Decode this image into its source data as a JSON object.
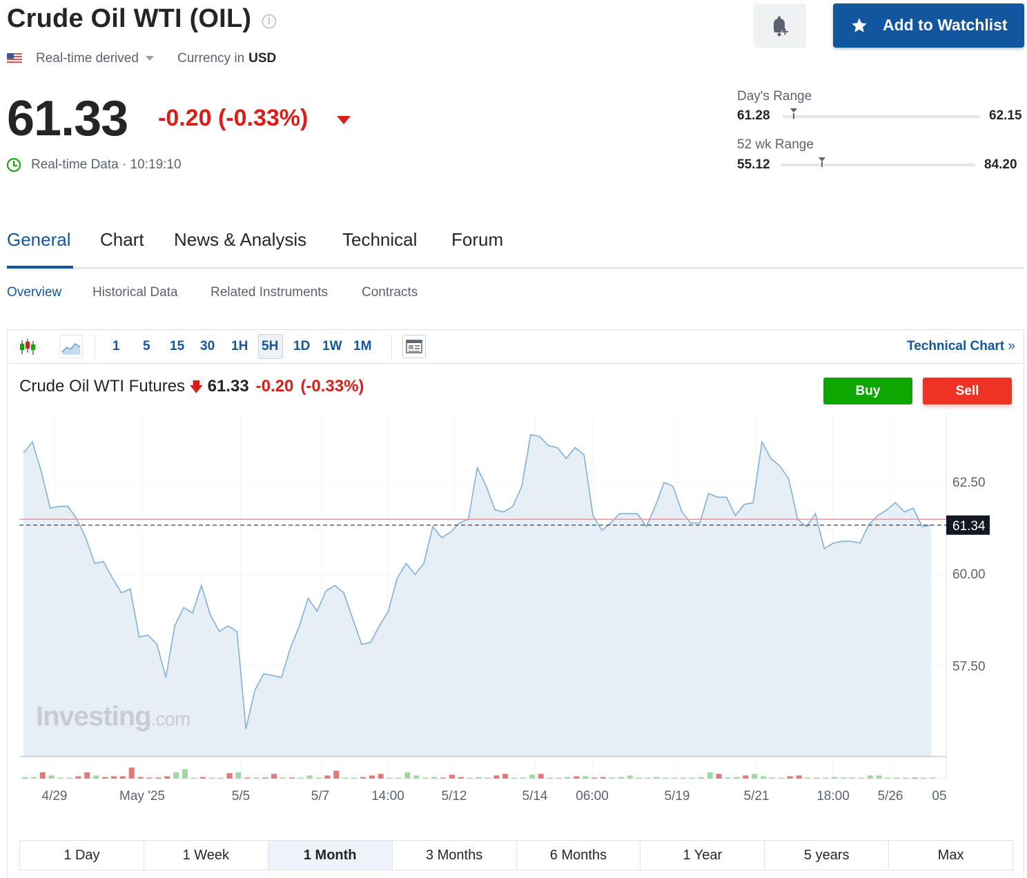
{
  "header": {
    "title": "Crude Oil WTI (OIL)",
    "source": "Real-time derived",
    "currency_label": "Currency in",
    "currency": "USD",
    "watchlist_label": "Add to Watchlist"
  },
  "quote": {
    "price": "61.33",
    "change": "-0.20",
    "change_pct": "(-0.33%)",
    "status": "Real-time Data · 10:19:10"
  },
  "ranges": {
    "day_label": "Day's Range",
    "day_low": "61.28",
    "day_high": "62.15",
    "day_current": 61.33,
    "wk52_label": "52 wk Range",
    "wk52_low": "55.12",
    "wk52_high": "84.20",
    "wk52_current": 61.33
  },
  "tabs": [
    {
      "label": "General",
      "active": true
    },
    {
      "label": "Chart"
    },
    {
      "label": "News & Analysis"
    },
    {
      "label": "Technical"
    },
    {
      "label": "Forum"
    }
  ],
  "subtabs": [
    {
      "label": "Overview",
      "active": true
    },
    {
      "label": "Historical Data"
    },
    {
      "label": "Related Instruments"
    },
    {
      "label": "Contracts"
    }
  ],
  "toolbar": {
    "intervals": [
      "1",
      "5",
      "15",
      "30",
      "1H",
      "5H",
      "1D",
      "1W",
      "1M"
    ],
    "selected_interval": "5H",
    "technical_chart_label": "Technical Chart",
    "icons": [
      "candlestick-icon",
      "area-chart-icon",
      "news-panel-icon"
    ]
  },
  "chart_header": {
    "name": "Crude Oil WTI Futures",
    "price": "61.33",
    "change": "-0.20",
    "change_pct": "(-0.33%)",
    "buy_label": "Buy",
    "sell_label": "Sell"
  },
  "chart_data": {
    "type": "area",
    "x_tick_labels": [
      "4/29",
      "May '25",
      "5/5",
      "5/7",
      "14:00",
      "5/12",
      "5/14",
      "06:00",
      "5/19",
      "5/21",
      "18:00",
      "5/26",
      "05"
    ],
    "y_tick_labels": [
      "62.50",
      "60.00",
      "57.50"
    ],
    "ylim": [
      55.05,
      64.3
    ],
    "current_price_label": "61.34",
    "current_price": 61.34,
    "reference_line": 61.5,
    "watermark": "Investing.com",
    "values": [
      63.3,
      63.6,
      62.8,
      61.8,
      61.85,
      61.85,
      61.5,
      61.0,
      60.3,
      60.35,
      59.9,
      59.5,
      59.6,
      58.3,
      58.35,
      58.1,
      57.2,
      58.6,
      59.1,
      58.95,
      59.7,
      58.9,
      58.45,
      58.6,
      58.45,
      55.8,
      56.85,
      57.3,
      57.25,
      57.2,
      58.0,
      58.6,
      59.35,
      59.0,
      59.55,
      59.7,
      59.5,
      58.8,
      58.1,
      58.15,
      58.6,
      59.0,
      59.9,
      60.3,
      60.0,
      60.3,
      61.3,
      61.0,
      61.15,
      61.4,
      61.5,
      62.9,
      62.4,
      61.75,
      61.7,
      61.85,
      62.4,
      63.8,
      63.75,
      63.5,
      63.45,
      63.15,
      63.45,
      63.25,
      61.6,
      61.2,
      61.4,
      61.65,
      61.65,
      61.65,
      61.3,
      61.85,
      62.5,
      62.4,
      61.7,
      61.4,
      61.4,
      62.2,
      62.1,
      62.1,
      61.6,
      61.9,
      61.95,
      63.6,
      63.15,
      62.95,
      62.6,
      61.5,
      61.3,
      61.65,
      60.7,
      60.85,
      60.9,
      60.9,
      60.85,
      61.35,
      61.6,
      61.75,
      61.95,
      61.7,
      61.8,
      61.3,
      61.34
    ],
    "volume": [
      {
        "v": 2,
        "c": "g"
      },
      {
        "v": 2,
        "c": "g"
      },
      {
        "v": 8,
        "c": "r"
      },
      {
        "v": 4,
        "c": "g"
      },
      {
        "v": 1,
        "c": "g"
      },
      {
        "v": 1,
        "c": "g"
      },
      {
        "v": 3,
        "c": "r"
      },
      {
        "v": 8,
        "c": "r"
      },
      {
        "v": 4,
        "c": "g"
      },
      {
        "v": 2,
        "c": "r"
      },
      {
        "v": 3,
        "c": "r"
      },
      {
        "v": 3,
        "c": "r"
      },
      {
        "v": 14,
        "c": "r"
      },
      {
        "v": 2,
        "c": "r"
      },
      {
        "v": 1,
        "c": "r"
      },
      {
        "v": 1,
        "c": "r"
      },
      {
        "v": 3,
        "c": "r"
      },
      {
        "v": 8,
        "c": "g"
      },
      {
        "v": 12,
        "c": "g"
      },
      {
        "v": 1,
        "c": "g"
      },
      {
        "v": 2,
        "c": "r"
      },
      {
        "v": 1,
        "c": "g"
      },
      {
        "v": 1,
        "c": "g"
      },
      {
        "v": 7,
        "c": "r"
      },
      {
        "v": 8,
        "c": "g"
      },
      {
        "v": 1,
        "c": "r"
      },
      {
        "v": 1,
        "c": "g"
      },
      {
        "v": 1,
        "c": "r"
      },
      {
        "v": 6,
        "c": "r"
      },
      {
        "v": 1,
        "c": "g"
      },
      {
        "v": 1,
        "c": "r"
      },
      {
        "v": 1,
        "c": "g"
      },
      {
        "v": 4,
        "c": "g"
      },
      {
        "v": 1,
        "c": "g"
      },
      {
        "v": 4,
        "c": "r"
      },
      {
        "v": 10,
        "c": "r"
      },
      {
        "v": 1,
        "c": "g"
      },
      {
        "v": 1,
        "c": "g"
      },
      {
        "v": 2,
        "c": "r"
      },
      {
        "v": 4,
        "c": "r"
      },
      {
        "v": 6,
        "c": "r"
      },
      {
        "v": 1,
        "c": "g"
      },
      {
        "v": 1,
        "c": "g"
      },
      {
        "v": 8,
        "c": "g"
      },
      {
        "v": 4,
        "c": "g"
      },
      {
        "v": 1,
        "c": "g"
      },
      {
        "v": 2,
        "c": "g"
      },
      {
        "v": 1,
        "c": "r"
      },
      {
        "v": 5,
        "c": "r"
      },
      {
        "v": 2,
        "c": "r"
      },
      {
        "v": 1,
        "c": "g"
      },
      {
        "v": 2,
        "c": "g"
      },
      {
        "v": 1,
        "c": "g"
      },
      {
        "v": 4,
        "c": "r"
      },
      {
        "v": 6,
        "c": "r"
      },
      {
        "v": 1,
        "c": "g"
      },
      {
        "v": 1,
        "c": "g"
      },
      {
        "v": 5,
        "c": "g"
      },
      {
        "v": 6,
        "c": "r"
      },
      {
        "v": 1,
        "c": "g"
      },
      {
        "v": 1,
        "c": "g"
      },
      {
        "v": 2,
        "c": "g"
      },
      {
        "v": 3,
        "c": "r"
      },
      {
        "v": 3,
        "c": "g"
      },
      {
        "v": 1,
        "c": "r"
      },
      {
        "v": 2,
        "c": "r"
      },
      {
        "v": 1,
        "c": "g"
      },
      {
        "v": 2,
        "c": "g"
      },
      {
        "v": 4,
        "c": "g"
      },
      {
        "v": 1,
        "c": "g"
      },
      {
        "v": 1,
        "c": "g"
      },
      {
        "v": 2,
        "c": "g"
      },
      {
        "v": 1,
        "c": "g"
      },
      {
        "v": 1,
        "c": "g"
      },
      {
        "v": 1,
        "c": "g"
      },
      {
        "v": 1,
        "c": "g"
      },
      {
        "v": 2,
        "c": "g"
      },
      {
        "v": 8,
        "c": "g"
      },
      {
        "v": 6,
        "c": "r"
      },
      {
        "v": 1,
        "c": "g"
      },
      {
        "v": 2,
        "c": "g"
      },
      {
        "v": 4,
        "c": "r"
      },
      {
        "v": 6,
        "c": "g"
      },
      {
        "v": 3,
        "c": "g"
      },
      {
        "v": 1,
        "c": "g"
      },
      {
        "v": 1,
        "c": "g"
      },
      {
        "v": 3,
        "c": "r"
      },
      {
        "v": 4,
        "c": "r"
      },
      {
        "v": 1,
        "c": "g"
      },
      {
        "v": 1,
        "c": "g"
      },
      {
        "v": 1,
        "c": "g"
      },
      {
        "v": 2,
        "c": "g"
      },
      {
        "v": 1,
        "c": "g"
      },
      {
        "v": 1,
        "c": "g"
      },
      {
        "v": 1,
        "c": "g"
      },
      {
        "v": 4,
        "c": "g"
      },
      {
        "v": 4,
        "c": "g"
      },
      {
        "v": 1,
        "c": "g"
      },
      {
        "v": 1,
        "c": "g"
      },
      {
        "v": 1,
        "c": "g"
      },
      {
        "v": 1,
        "c": "r"
      },
      {
        "v": 1,
        "c": "g"
      },
      {
        "v": 1,
        "c": "g"
      }
    ]
  },
  "periods": [
    {
      "label": "1 Day"
    },
    {
      "label": "1 Week"
    },
    {
      "label": "1 Month",
      "active": true
    },
    {
      "label": "3 Months"
    },
    {
      "label": "6 Months"
    },
    {
      "label": "1 Year"
    },
    {
      "label": "5 years"
    },
    {
      "label": "Max"
    }
  ],
  "colors": {
    "brand_blue": "#1256a0",
    "negative": "#d91e18",
    "positive": "#0ea600",
    "sell": "#ee3224",
    "area_fill": "#e6eef6",
    "area_line": "#7fb0d9"
  }
}
